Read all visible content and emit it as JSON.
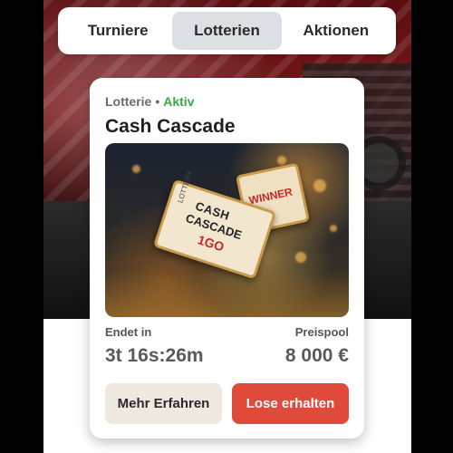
{
  "tabs": [
    {
      "label": "Turniere"
    },
    {
      "label": "Lotterien"
    },
    {
      "label": "Aktionen"
    }
  ],
  "card": {
    "category": "Lotterie",
    "separator": "•",
    "status": "Aktiv",
    "title": "Cash Cascade",
    "ticket_text": {
      "side": "LOTTERY",
      "line1": "CASH",
      "line2": "CASCADE",
      "number": "1",
      "go": "GO",
      "winner": "WINNER"
    },
    "ends_label": "Endet in",
    "ends_value": "3t 16s:26m",
    "pool_label": "Preispool",
    "pool_value": "8 000 €",
    "secondary_button": "Mehr Erfahren",
    "primary_button": "Lose erhalten"
  },
  "colors": {
    "active_status": "#3aa845",
    "primary_button": "#e04a3b",
    "secondary_button": "#efe8de",
    "active_tab": "#dcdfe4"
  }
}
